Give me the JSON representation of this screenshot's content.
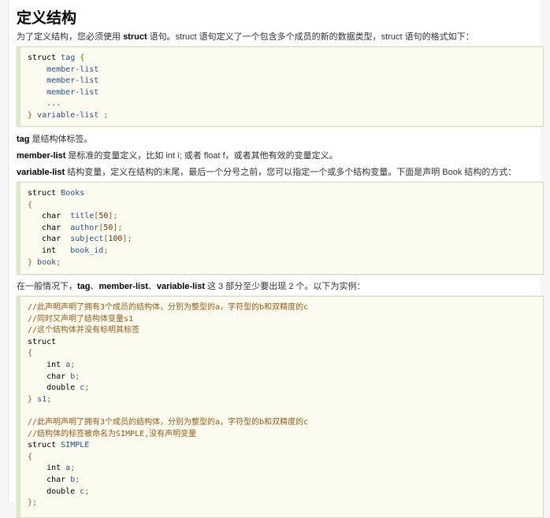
{
  "heading": "定义结构",
  "intro": {
    "pre": "为了定义结构，您必须使用 ",
    "kw": "struct",
    "post": " 语句。struct 语句定义了一个包含多个成员的新的数据类型，struct 语句的格式如下："
  },
  "code1": [
    [
      [
        "kw",
        "struct "
      ],
      [
        "id",
        "tag "
      ],
      [
        "pn",
        "{"
      ]
    ],
    [
      [
        "kw",
        "    "
      ],
      [
        "id",
        "member-list"
      ]
    ],
    [
      [
        "kw",
        "    "
      ],
      [
        "id",
        "member-list"
      ]
    ],
    [
      [
        "kw",
        "    "
      ],
      [
        "id",
        "member-list"
      ]
    ],
    [
      [
        "kw",
        "    "
      ],
      [
        "id",
        "..."
      ]
    ],
    [
      [
        "pn",
        "} "
      ],
      [
        "id",
        "variable-list "
      ],
      [
        "pn",
        ";"
      ]
    ]
  ],
  "desc": [
    {
      "term": "tag",
      "text": " 是结构体标签。"
    },
    {
      "term": "member-list",
      "text": " 是标准的变量定义，比如 int i; 或者 float f，或者其他有效的变量定义。"
    },
    {
      "term": "variable-list",
      "text": " 结构变量，定义在结构的末尾，最后一个分号之前，您可以指定一个或多个结构变量。下面是声明 Book 结构的方式："
    }
  ],
  "code2": [
    [
      [
        "kw",
        "struct "
      ],
      [
        "id",
        "Books"
      ]
    ],
    [
      [
        "pn",
        "{"
      ]
    ],
    [
      [
        "kw",
        "   char  "
      ],
      [
        "id",
        "title"
      ],
      [
        "pn",
        "["
      ],
      [
        "nm",
        "50"
      ],
      [
        "pn",
        "];"
      ]
    ],
    [
      [
        "kw",
        "   char  "
      ],
      [
        "id",
        "author"
      ],
      [
        "pn",
        "["
      ],
      [
        "nm",
        "50"
      ],
      [
        "pn",
        "];"
      ]
    ],
    [
      [
        "kw",
        "   char  "
      ],
      [
        "id",
        "subject"
      ],
      [
        "pn",
        "["
      ],
      [
        "nm",
        "100"
      ],
      [
        "pn",
        "];"
      ]
    ],
    [
      [
        "kw",
        "   int   "
      ],
      [
        "id",
        "book_id"
      ],
      [
        "pn",
        ";"
      ]
    ],
    [
      [
        "pn",
        "} "
      ],
      [
        "id",
        "book"
      ],
      [
        "pn",
        ";"
      ]
    ]
  ],
  "note": {
    "pre": "在一般情况下，",
    "t1": "tag",
    "s1": "、",
    "t2": "member-list",
    "s2": "、",
    "t3": "variable-list",
    "post": " 这 3 部分至少要出现 2 个。以下为实例："
  },
  "code3": [
    [
      [
        "cm",
        "//此声明声明了拥有3个成员的结构体，分别为整型的a，字符型的b和双精度的c"
      ]
    ],
    [
      [
        "cm",
        "//同时又声明了结构体变量s1"
      ]
    ],
    [
      [
        "cm",
        "//这个结构体并没有标明其标签"
      ]
    ],
    [
      [
        "kw",
        "struct"
      ]
    ],
    [
      [
        "pn",
        "{"
      ]
    ],
    [
      [
        "kw",
        "    int "
      ],
      [
        "id",
        "a"
      ],
      [
        "pn",
        ";"
      ]
    ],
    [
      [
        "kw",
        "    char "
      ],
      [
        "id",
        "b"
      ],
      [
        "pn",
        ";"
      ]
    ],
    [
      [
        "kw",
        "    double "
      ],
      [
        "id",
        "c"
      ],
      [
        "pn",
        ";"
      ]
    ],
    [
      [
        "pn",
        "} "
      ],
      [
        "id",
        "s1"
      ],
      [
        "pn",
        ";"
      ]
    ],
    [
      [
        "kw",
        " "
      ]
    ],
    [
      [
        "cm",
        "//此声明声明了拥有3个成员的结构体，分别为整型的a，字符型的b和双精度的c"
      ]
    ],
    [
      [
        "cm",
        "//结构体的标签被命名为SIMPLE,没有声明变量"
      ]
    ],
    [
      [
        "kw",
        "struct "
      ],
      [
        "id",
        "SIMPLE"
      ]
    ],
    [
      [
        "pn",
        "{"
      ]
    ],
    [
      [
        "kw",
        "    int "
      ],
      [
        "id",
        "a"
      ],
      [
        "pn",
        ";"
      ]
    ],
    [
      [
        "kw",
        "    char "
      ],
      [
        "id",
        "b"
      ],
      [
        "pn",
        ";"
      ]
    ],
    [
      [
        "kw",
        "    double "
      ],
      [
        "id",
        "c"
      ],
      [
        "pn",
        ";"
      ]
    ],
    [
      [
        "pn",
        "};"
      ]
    ]
  ]
}
